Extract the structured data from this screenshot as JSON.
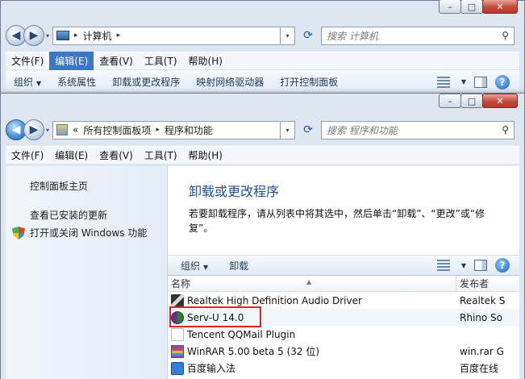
{
  "window1": {
    "breadcrumb": [
      "计算机"
    ],
    "search_placeholder": "搜索 计算机",
    "menu": [
      "文件(F)",
      "编辑(E)",
      "查看(V)",
      "工具(T)",
      "帮助(H)"
    ],
    "toolbar": [
      "组织",
      "系统属性",
      "卸载或更改程序",
      "映射网络驱动器",
      "打开控制面板"
    ]
  },
  "window2": {
    "breadcrumb_prefix": "«",
    "breadcrumb": [
      "所有控制面板项",
      "程序和功能"
    ],
    "search_placeholder": "搜索 程序和功能",
    "menu": [
      "文件(F)",
      "编辑(E)",
      "查看(V)",
      "工具(T)",
      "帮助(H)"
    ],
    "sidebar": {
      "links": [
        "控制面板主页",
        "查看已安装的更新",
        "打开或关闭 Windows 功能"
      ]
    },
    "heading": "卸载或更改程序",
    "description": "若要卸载程序，请从列表中将其选中，然后单击“卸载”、“更改”或“修复”。",
    "list_toolbar": [
      "组织",
      "卸载"
    ],
    "columns": [
      "名称",
      "发布者"
    ],
    "programs": [
      {
        "name": "Realtek High Definition Audio Driver",
        "publisher": "Realtek S",
        "icon": "realtek-icon"
      },
      {
        "name": "Serv-U 14.0",
        "publisher": "Rhino So",
        "icon": "serv-u-icon"
      },
      {
        "name": "Tencent QQMail Plugin",
        "publisher": "",
        "icon": "tencent-icon"
      },
      {
        "name": "WinRAR 5.00 beta 5 (32 位)",
        "publisher": "win.rar G",
        "icon": "winrar-icon"
      },
      {
        "name": "百度输入法",
        "publisher": "百度在线",
        "icon": "baidu-icon"
      }
    ]
  },
  "colors": {
    "highlight_box": "#e0261c",
    "heading": "#1e4f96",
    "menu_selected": "#3a77c7"
  }
}
